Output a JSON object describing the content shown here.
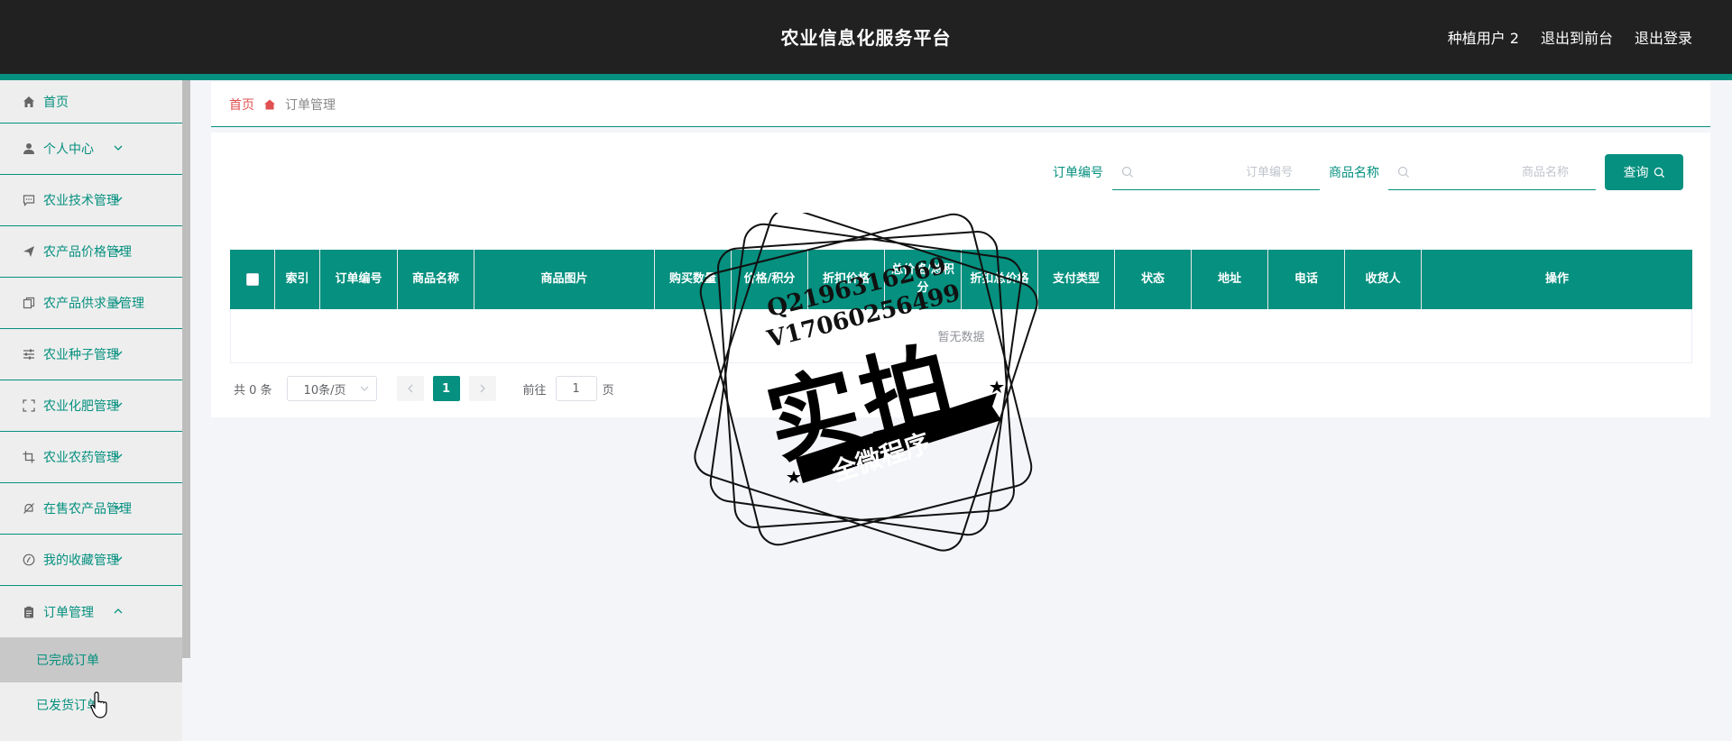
{
  "header": {
    "title": "农业信息化服务平台",
    "user": "种植用户 2",
    "to_front": "退出到前台",
    "logout": "退出登录"
  },
  "sidebar": {
    "items": [
      {
        "label": "首页",
        "icon": "home-icon"
      },
      {
        "label": "个人中心",
        "icon": "user-icon"
      },
      {
        "label": "农业技术管理",
        "icon": "chat-icon"
      },
      {
        "label": "农产品价格管理",
        "icon": "send-icon"
      },
      {
        "label": "农产品供求量管理",
        "icon": "copy-icon"
      },
      {
        "label": "农业种子管理",
        "icon": "sliders-icon"
      },
      {
        "label": "农业化肥管理",
        "icon": "fullscreen-icon"
      },
      {
        "label": "农业农药管理",
        "icon": "crop-icon"
      },
      {
        "label": "在售农产品管理",
        "icon": "bell-off-icon"
      },
      {
        "label": "我的收藏管理",
        "icon": "compass-icon"
      },
      {
        "label": "订单管理",
        "icon": "clipboard-icon"
      }
    ],
    "submenu": [
      "已完成订单",
      "已发货订单"
    ]
  },
  "breadcrumb": {
    "home": "首页",
    "current": "订单管理"
  },
  "search": {
    "order_label": "订单编号",
    "order_placeholder": "订单编号",
    "product_label": "商品名称",
    "product_placeholder": "商品名称",
    "query_label": "查询"
  },
  "table": {
    "columns": [
      "索引",
      "订单编号",
      "商品名称",
      "商品图片",
      "购买数量",
      "价格/积分",
      "折扣价格",
      "总价格/总积分",
      "折扣总价格",
      "支付类型",
      "状态",
      "地址",
      "电话",
      "收货人",
      "操作"
    ],
    "empty_text": "暂无数据"
  },
  "pagination": {
    "total": "共 0 条",
    "page_size": "10条/页",
    "current_page": "1",
    "goto_prefix": "前往",
    "goto_value": "1",
    "goto_suffix": "页"
  },
  "watermark": {
    "qq": "Q2196316269",
    "vx": "V17060256499",
    "main": "实拍",
    "ribbon": "全微程序"
  },
  "colors": {
    "accent": "#05907f",
    "topbar": "#212121",
    "crumb_home": "#e05050"
  }
}
